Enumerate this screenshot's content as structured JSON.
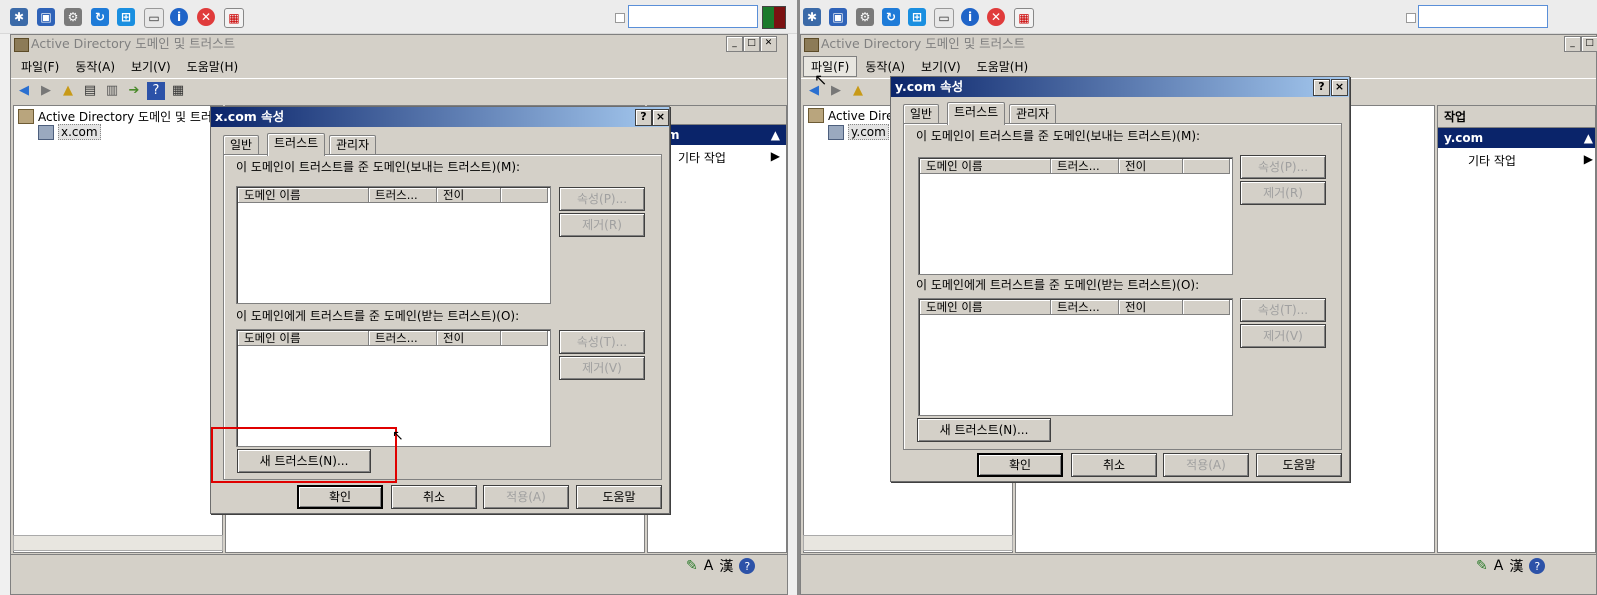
{
  "left": {
    "window_title": "Active Directory 도메인 및 트러스트",
    "menu": [
      "파일(F)",
      "동작(A)",
      "보기(V)",
      "도움말(H)"
    ],
    "tree_root": "Active Directory 도메인 및 트러스",
    "tree_child": "x.com",
    "actions_partial": ":om",
    "actions_sub": "기타 작업",
    "dialog": {
      "title": "x.com 속성",
      "help": "?",
      "close": "×",
      "tabs": [
        "일반",
        "트러스트",
        "관리자"
      ],
      "outgoing_label": "이 도메인이 트러스트를 준 도메인(보내는 트러스트)(M):",
      "incoming_label": "이 도메인에게 트러스트를 준 도메인(받는 트러스트)(O):",
      "columns": [
        "도메인 이름",
        "트러스...",
        "전이"
      ],
      "out_props": "속성(P)...",
      "out_remove": "제거(R)",
      "in_props": "속성(T)...",
      "in_remove": "제거(V)",
      "new_trust": "새 트러스트(N)...",
      "ok": "확인",
      "cancel": "취소",
      "apply": "적용(A)",
      "helpbtn": "도움말"
    }
  },
  "right": {
    "window_title": "Active Directory 도메인 및 트러스트",
    "menu": [
      "파일(F)",
      "동작(A)",
      "보기(V)",
      "도움말(H)"
    ],
    "tree_root": "Active Direc",
    "tree_child": "y.com",
    "actions_header": "작업",
    "actions_item": "y.com",
    "actions_sub": "기타 작업",
    "dialog": {
      "title": "y.com 속성",
      "help": "?",
      "close": "×",
      "tabs": [
        "일반",
        "트러스트",
        "관리자"
      ],
      "outgoing_label": "이 도메인이 트러스트를 준 도메인(보내는 트러스트)(M):",
      "incoming_label": "이 도메인에게 트러스트를 준 도메인(받는 트러스트)(O):",
      "columns": [
        "도메인 이름",
        "트러스...",
        "전이"
      ],
      "out_props": "속성(P)...",
      "out_remove": "제거(R)",
      "in_props": "속성(T)...",
      "in_remove": "제거(V)",
      "new_trust": "새 트러스트(N)...",
      "ok": "확인",
      "cancel": "취소",
      "apply": "적용(A)",
      "helpbtn": "도움말"
    }
  },
  "tray": {
    "ime_a": "A",
    "ime_han": "漢",
    "help": "?"
  },
  "colors": {
    "title_active": "#0a246a",
    "title_gradient_end": "#a6caf0",
    "highlight_box": "#e00000",
    "chrome": "#d4d0c8"
  },
  "icons": [
    "network-icon",
    "screen-icon",
    "gear-icon",
    "refresh-icon",
    "windows-icon",
    "document-icon",
    "info-icon",
    "close-icon",
    "calendar-icon",
    "back-arrow-icon",
    "forward-arrow-icon",
    "up-folder-icon",
    "console-tree-icon",
    "export-icon",
    "help-icon",
    "ime-icon"
  ]
}
